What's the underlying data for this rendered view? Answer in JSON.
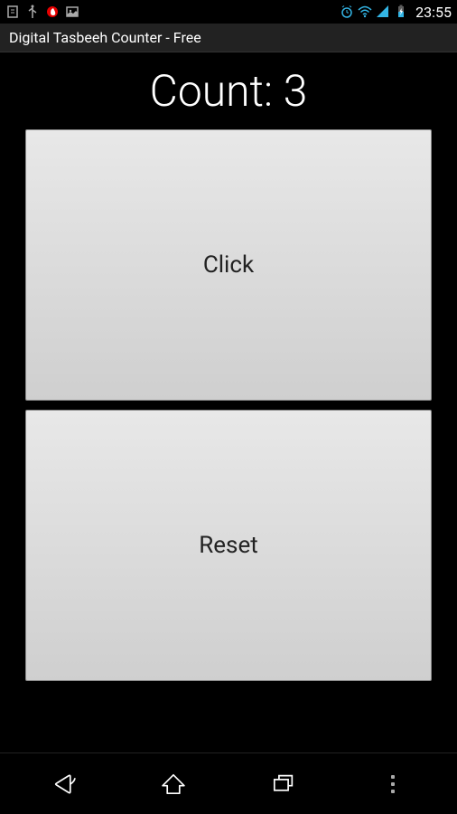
{
  "status_bar": {
    "time": "23:55"
  },
  "title_bar": {
    "title": "Digital Tasbeeh Counter - Free"
  },
  "main": {
    "count_label": "Count: 3",
    "click_label": "Click",
    "reset_label": "Reset"
  }
}
